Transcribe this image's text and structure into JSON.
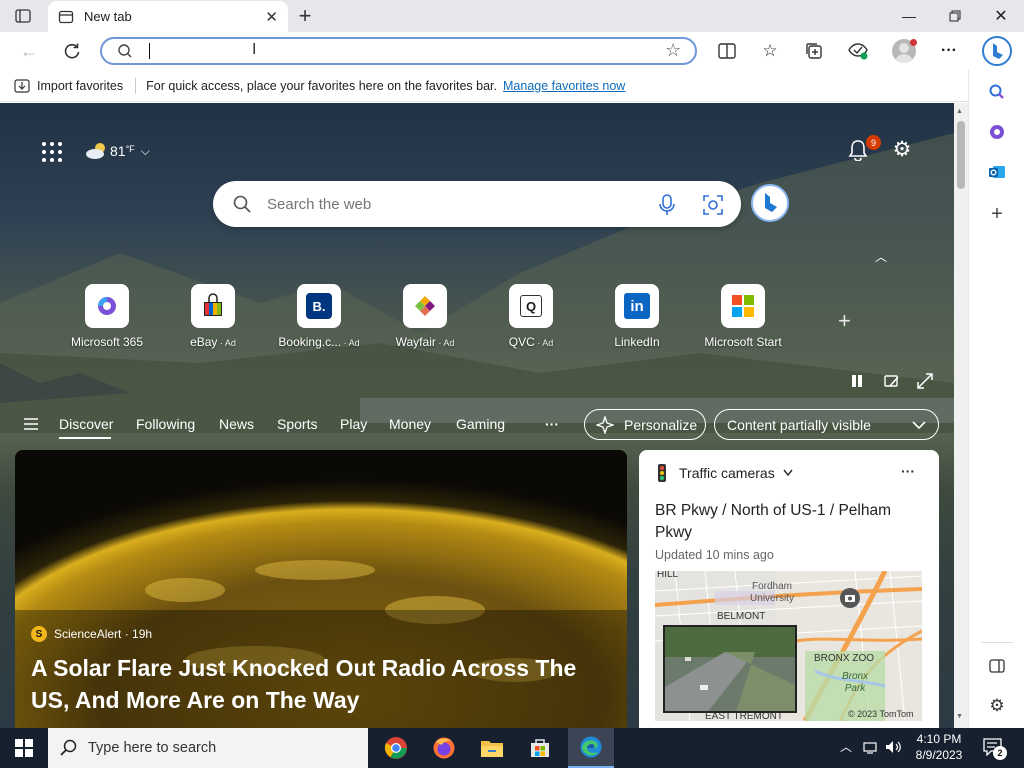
{
  "tab": {
    "title": "New tab"
  },
  "favorites": {
    "import_label": "Import favorites",
    "message": "For quick access, place your favorites here on the favorites bar.",
    "manage_link": "Manage favorites now"
  },
  "header": {
    "weather_temp": "81",
    "weather_unit": "°F",
    "notif_count": "9"
  },
  "search": {
    "placeholder": "Search the web"
  },
  "tiles": [
    {
      "label": "Microsoft 365",
      "ad": ""
    },
    {
      "label": "eBay",
      "ad": " · Ad"
    },
    {
      "label": "Booking.c...",
      "ad": " · Ad"
    },
    {
      "label": "Wayfair",
      "ad": " · Ad"
    },
    {
      "label": "QVC",
      "ad": " · Ad"
    },
    {
      "label": "LinkedIn",
      "ad": ""
    },
    {
      "label": "Microsoft Start",
      "ad": ""
    }
  ],
  "feed_nav": {
    "items": [
      "Discover",
      "Following",
      "News",
      "Sports",
      "Play",
      "Money",
      "Gaming"
    ],
    "more": "···",
    "personalize": "Personalize",
    "visibility": "Content partially visible"
  },
  "hero": {
    "source": "ScienceAlert · 19h",
    "headline": "A Solar Flare Just Knocked Out Radio Across The US, And More Are on The Way"
  },
  "traffic": {
    "title": "Traffic cameras",
    "location": "BR Pkwy / North of US-1 / Pelham Pkwy",
    "updated": "Updated 10 mins ago",
    "map_labels": [
      "HILL",
      "Fordham University",
      "BELMONT",
      "BRONX ZOO",
      "Bronx Park",
      "EAST TREMONT"
    ],
    "copyright": "© 2023 TomTom"
  },
  "taskbar": {
    "search_placeholder": "Type here to search",
    "time": "4:10 PM",
    "date": "8/9/2023",
    "notif_count": "2"
  }
}
